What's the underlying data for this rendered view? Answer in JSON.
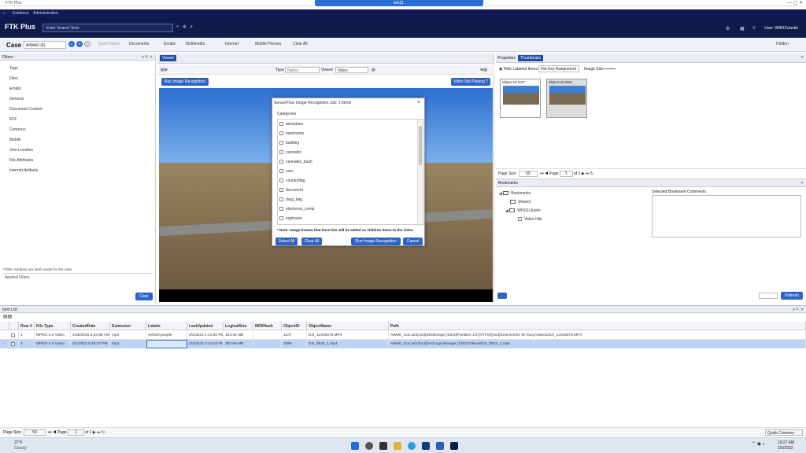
{
  "window": {
    "title": "FTK Plus"
  },
  "remote": {
    "name": "win11"
  },
  "menu": {
    "evidence": "Evidence",
    "administration": "Administration"
  },
  "header": {
    "logo": "FTK Plus",
    "search_placeholder": "Enter Search Term",
    "user": "User: WIN11\\Justin"
  },
  "toolbar": {
    "case_label": "Case",
    "case_value": "AiMeb2 (6)",
    "quick_filters": "Quick Filters",
    "documents": "Documents",
    "emails": "Emails",
    "multimedia": "Multimedia",
    "internet": "Internet",
    "mobile_phones": "Mobile Phones",
    "clear_all": "Clear All",
    "hidden": "Hidden"
  },
  "filters": {
    "title": "Filters",
    "items": [
      "Tags",
      "Files",
      "Emails",
      "General",
      "Document Content",
      "KFF",
      "Cerberus",
      "Mobile",
      "Geo-Location",
      "File Attributes",
      "Internet Artifacts"
    ],
    "note": "*Filter numbers are total counts for the case",
    "applied": "Applied Filters",
    "clear": "Clear"
  },
  "viewer": {
    "tab": "Viewer",
    "type_label": "Type",
    "type_value": "Native",
    "viewer_label": "Viewer",
    "viewer_value": "Video",
    "run_button": "Run Image Recognition",
    "status_button": "Video Not Playing ?"
  },
  "dialog": {
    "title": "SensorFlow Image Recognition Job: 1 Items",
    "categories_label": "Categories",
    "categories": [
      "aeroplane",
      "banknotes",
      "building",
      "cannabis",
      "cannabis_bush",
      "coin",
      "countryflag",
      "document",
      "drug_bag",
      "electronic_comp",
      "explosive"
    ],
    "note": "* Note: Image frames that have hits will be added as children items to the video.",
    "select_all": "Select All",
    "clear_all": "Clear All",
    "run": "Run Image Recognition",
    "cancel": "Cancel"
  },
  "properties": {
    "tab_properties": "Properties",
    "tab_thumbnails": "Thumbnails",
    "hide_labeled": "Hide Labeled Items",
    "hot_key": "Hot Key Assignment",
    "image_size": "Image Size",
    "thumb1": "Object Id:1107",
    "thumb2": "Object Id:2058",
    "page_size": "Page Size",
    "page_size_value": "50",
    "page_label": "Page",
    "page_value": "1",
    "of_label": "of 1"
  },
  "bookmarks": {
    "title": "Bookmarks",
    "root": "Bookmarks",
    "shared": "Shared",
    "user": "WIN11\\Justin",
    "video_hits": "Video Hits",
    "comments": "Selected Bookmark Comments",
    "refresh": "Refresh"
  },
  "itemlist": {
    "title": "Item List",
    "columns": [
      "Row #",
      "File Type",
      "CreatedDate",
      "Extension",
      "Labels",
      "LastUpdated",
      "LogicalSize",
      "MD5Hash",
      "ObjectID",
      "ObjectName",
      "Path"
    ],
    "rows": [
      [
        "1",
        "MPEG-4.0 Video",
        "4/30/2020 5:34:59 AM",
        "mp4",
        "vehicle,people",
        "2/2/2022 4:14:50 PM",
        "103.34 MB",
        "",
        "1107",
        "DJI_12345678.MP4",
        "AIMeb_Cus.ad1[root]/Diskimage [1001]/Partition 1/3 [NTFS]/[root]/Users/John W Gacy/Videos/DJI_12345678.MP4"
      ],
      [
        "2",
        "MPEG-4.0 Video",
        "2/1/2022 6:18:37 PM",
        "mp4",
        "",
        "2/2/2022 4:14:16 PM",
        "302.66 MB",
        "",
        "2058",
        "DJI_0043_1.mp4",
        "AIMeb_Cus.ad1/[root]/AOLogicalImage [1001]/Videos/DJI_0043_1.mp4"
      ]
    ],
    "page_size": "Page Size",
    "page_size_value": "50",
    "page_label": "Page",
    "page_value": "1",
    "of_label": "of 1",
    "quick_columns": "Quick Columns"
  },
  "taskbar": {
    "weather_temp": "37°F",
    "weather_desc": "Cloudy",
    "time": "10:27 AM",
    "date": "2/2/2022"
  }
}
